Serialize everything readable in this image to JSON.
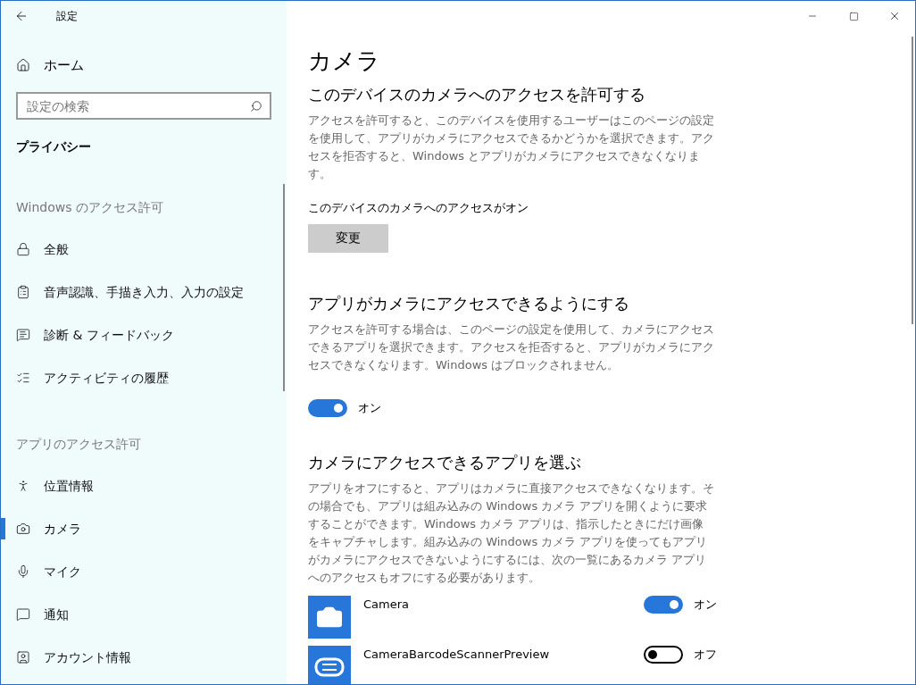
{
  "window": {
    "title": "設定"
  },
  "sidebar": {
    "home": "ホーム",
    "search": {
      "placeholder": "設定の検索"
    },
    "heading": "プライバシー",
    "groups": [
      {
        "title": "Windows のアクセス許可",
        "items": [
          {
            "label": "全般",
            "selected": false
          },
          {
            "label": "音声認識、手描き入力、入力の設定",
            "selected": false
          },
          {
            "label": "診断 & フィードバック",
            "selected": false
          },
          {
            "label": "アクティビティの履歴",
            "selected": false
          }
        ]
      },
      {
        "title": "アプリのアクセス許可",
        "items": [
          {
            "label": "位置情報",
            "selected": false
          },
          {
            "label": "カメラ",
            "selected": true
          },
          {
            "label": "マイク",
            "selected": false
          },
          {
            "label": "通知",
            "selected": false
          },
          {
            "label": "アカウント情報",
            "selected": false
          }
        ]
      }
    ]
  },
  "page": {
    "title": "カメラ",
    "device_section": {
      "heading": "このデバイスのカメラへのアクセスを許可する",
      "description": "アクセスを許可すると、このデバイスを使用するユーザーはこのページの設定を使用して、アプリがカメラにアクセスできるかどうかを選択できます。アクセスを拒否すると、Windows とアプリがカメラにアクセスできなくなります。",
      "status": "このデバイスのカメラへのアクセスがオン",
      "button": "変更"
    },
    "apps_section": {
      "heading": "アプリがカメラにアクセスできるようにする",
      "description": "アクセスを許可する場合は、このページの設定を使用して、カメラにアクセスできるアプリを選択できます。アクセスを拒否すると、アプリがカメラにアクセスできなくなります。Windows はブロックされません。",
      "toggle": {
        "on": true,
        "label": "オン"
      }
    },
    "choose_section": {
      "heading": "カメラにアクセスできるアプリを選ぶ",
      "description": "アプリをオフにすると、アプリはカメラに直接アクセスできなくなります。その場合でも、アプリは組み込みの Windows カメラ アプリを開くように要求することができます。Windows カメラ アプリは、指示したときにだけ画像をキャプチャします。組み込みの Windows カメラ アプリを使ってもアプリがカメラにアクセスできないようにするには、次の一覧にあるカメラ アプリへのアクセスもオフにする必要があります。",
      "apps": [
        {
          "name": "Camera",
          "on": true,
          "label": "オン"
        },
        {
          "name": "CameraBarcodeScannerPreview",
          "on": false,
          "label": "オフ"
        }
      ]
    }
  }
}
